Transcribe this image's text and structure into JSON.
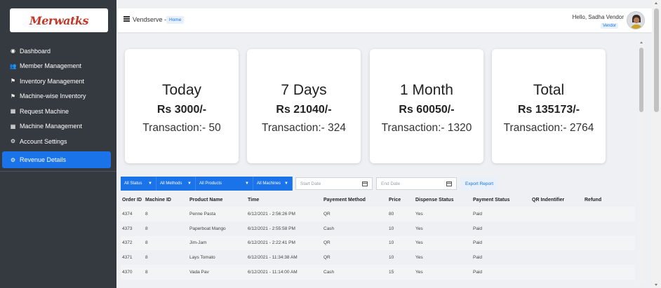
{
  "sidebar": {
    "logo_text": "Merwatks",
    "items": [
      {
        "label": "Dashboard",
        "icon": "tachometer-icon",
        "glyph": "◉"
      },
      {
        "label": "Member Management",
        "icon": "users-icon",
        "glyph": "👥"
      },
      {
        "label": "Inventory Management",
        "icon": "box-icon",
        "glyph": "⚑"
      },
      {
        "label": "Machine-wise Inventory",
        "icon": "box-icon",
        "glyph": "⚑"
      },
      {
        "label": "Request Machine",
        "icon": "table-icon",
        "glyph": "▦"
      },
      {
        "label": "Machine Management",
        "icon": "table-icon",
        "glyph": "▦"
      },
      {
        "label": "Account Settings",
        "icon": "cogs-icon",
        "glyph": "⚙"
      }
    ],
    "active_item": {
      "label": "Revenue Details",
      "icon": "cogs-icon",
      "glyph": "⚙"
    },
    "active_color": "#1a73e8",
    "bg_color": "#343a40"
  },
  "header": {
    "brand": "Vendserve -",
    "breadcrumb": "Home",
    "greeting": "Hello, Sadha Vendor",
    "role": "Vendor"
  },
  "cards": [
    {
      "period": "Today",
      "amount": "Rs 3000/-",
      "transactions": "Transaction:- 50"
    },
    {
      "period": "7 Days",
      "amount": "Rs 21040/-",
      "transactions": "Transaction:- 324"
    },
    {
      "period": "1 Month",
      "amount": "Rs 60050/-",
      "transactions": "Transaction:- 1320"
    },
    {
      "period": "Total",
      "amount": "Rs 135173/-",
      "transactions": "Transaction:- 2764"
    }
  ],
  "filters": {
    "status": "All Status",
    "methods": "All Methods",
    "products": "All Products",
    "machines": "All Machines",
    "start_date_placeholder": "Start Date",
    "end_date_placeholder": "End Date",
    "export_label": "Export Report"
  },
  "table": {
    "columns": [
      "Order ID",
      "Machine ID",
      "Product Name",
      "Time",
      "Payement Method",
      "Price",
      "Dispense Status",
      "Payment Status",
      "QR Indentifier",
      "Refund"
    ],
    "rows": [
      [
        "4374",
        "8",
        "Penne Pasta",
        "6/12/2021 - 2:56:26 PM",
        "QR",
        "80",
        "Yes",
        "Paid",
        "",
        ""
      ],
      [
        "4373",
        "8",
        "Paperboat Mango",
        "6/12/2021 - 2:55:58 PM",
        "Cash",
        "10",
        "Yes",
        "Paid",
        "",
        ""
      ],
      [
        "4372",
        "8",
        "Jim-Jam",
        "6/12/2021 - 2:22:41 PM",
        "QR",
        "10",
        "Yes",
        "Paid",
        "",
        ""
      ],
      [
        "4371",
        "8",
        "Lays Tomato",
        "6/12/2021 - 11:34:38 AM",
        "QR",
        "10",
        "Yes",
        "Paid",
        "",
        ""
      ],
      [
        "4370",
        "8",
        "Vada Pav",
        "6/12/2021 - 11:14:00 AM",
        "Cash",
        "15",
        "Yes",
        "Paid",
        "",
        ""
      ]
    ]
  }
}
